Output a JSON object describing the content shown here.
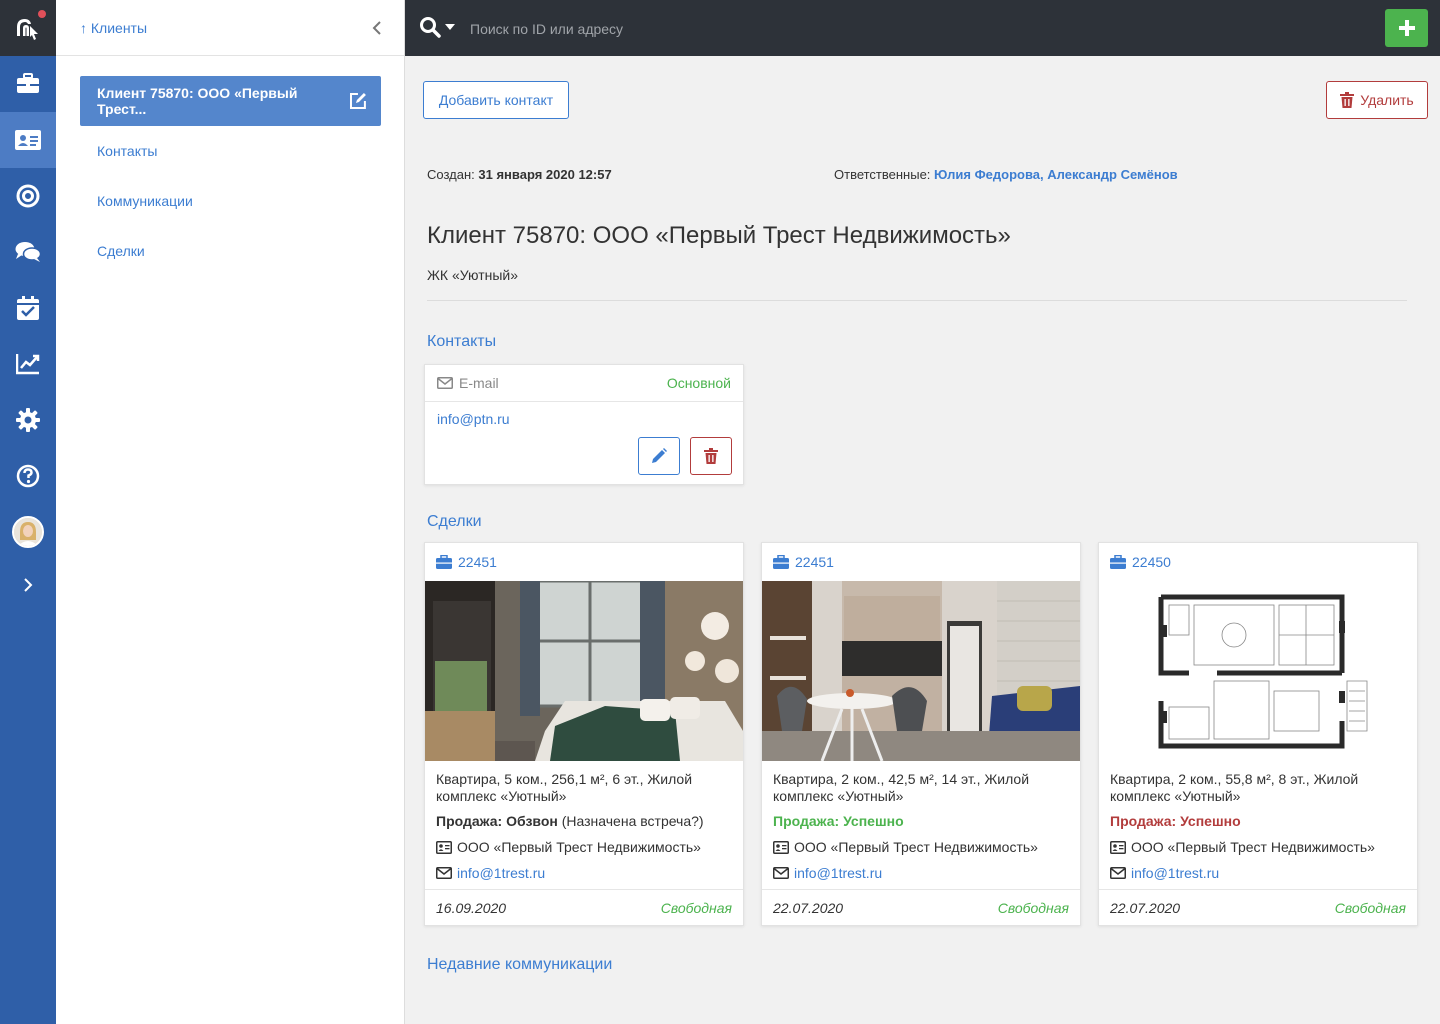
{
  "colors": {
    "rail": "#2f5fa8",
    "rail_active": "#4d7cc4",
    "topbar": "#2d3239",
    "link": "#3c7dd1",
    "success": "#4cb34e",
    "danger": "#b23c3c"
  },
  "rail": {
    "items": [
      {
        "icon": "briefcase-icon"
      },
      {
        "icon": "contact-card-icon",
        "active": true
      },
      {
        "icon": "target-icon"
      },
      {
        "icon": "chat-icon"
      },
      {
        "icon": "calendar-check-icon"
      },
      {
        "icon": "chart-line-icon"
      },
      {
        "icon": "gear-icon"
      },
      {
        "icon": "question-icon"
      },
      {
        "icon": "avatar"
      },
      {
        "icon": "chevron-right-icon"
      }
    ]
  },
  "panel": {
    "back_label": "↑ Клиенты",
    "active_label": "Клиент 75870: ООО «Первый Трест...",
    "nav": [
      "Контакты",
      "Коммуникации",
      "Сделки"
    ]
  },
  "topbar": {
    "search_placeholder": "Поиск по ID или адресу"
  },
  "actions": {
    "add_contact": "Добавить контакт",
    "delete": "Удалить"
  },
  "meta": {
    "created_label": "Создан:",
    "created_value": "31 января 2020 12:57",
    "responsible_label": "Ответственные:",
    "responsible_value": "Юлия Федорова, Александр Семёнов"
  },
  "client": {
    "title": "Клиент 75870: ООО «Первый Трест Недвижимость»",
    "subtitle": "ЖК «Уютный»"
  },
  "sections": {
    "contacts": "Контакты",
    "deals": "Сделки",
    "communications": "Недавние коммуникации"
  },
  "contact": {
    "type": "E-mail",
    "primary": "Основной",
    "value": "info@ptn.ru"
  },
  "deals": [
    {
      "id": "22451",
      "desc": "Квартира, 5 ком., 256,1 м², 6 эт., Жилой комплекс «Уютный»",
      "status_bold": "Продажа: Обзвон",
      "status_rest": " (Назначена встреча?)",
      "status_color": "#333333",
      "company": "ООО «Первый Трест Недвижимость»",
      "email": "info@1trest.ru",
      "date": "16.09.2020",
      "availability": "Свободная"
    },
    {
      "id": "22451",
      "desc": "Квартира, 2 ком., 42,5 м², 14 эт., Жилой комплекс «Уютный»",
      "status_bold": "Продажа: Успешно",
      "status_rest": "",
      "status_color": "#4cb34e",
      "company": "ООО «Первый Трест Недвижимость»",
      "email": "info@1trest.ru",
      "date": "22.07.2020",
      "availability": "Свободная"
    },
    {
      "id": "22450",
      "desc": "Квартира, 2 ком., 55,8 м², 8 эт., Жилой комплекс «Уютный»",
      "status_bold": "Продажа: Успешно",
      "status_rest": "",
      "status_color": "#b23c3c",
      "company": "ООО «Первый Трест Недвижимость»",
      "email": "info@1trest.ru",
      "date": "22.07.2020",
      "availability": "Свободная"
    }
  ]
}
